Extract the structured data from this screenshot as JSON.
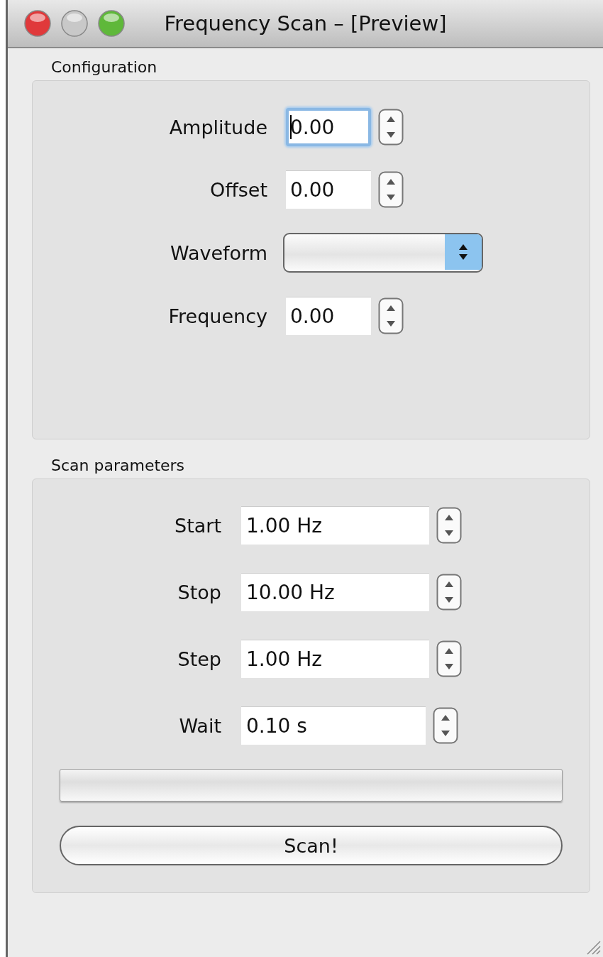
{
  "window": {
    "title": "Frequency Scan – [Preview]",
    "buttons": [
      {
        "kind": "close",
        "disabled": false
      },
      {
        "kind": "minimize",
        "disabled": true
      },
      {
        "kind": "zoom",
        "disabled": false
      }
    ]
  },
  "configuration": {
    "title": "Configuration",
    "fields": [
      {
        "kind": "spin",
        "label": "Amplitude",
        "value": "0.00",
        "focused": true
      },
      {
        "kind": "spin",
        "label": "Offset",
        "value": "0.00",
        "focused": false
      },
      {
        "kind": "dropdown",
        "label": "Waveform",
        "focused": false
      },
      {
        "kind": "spin",
        "label": "Frequency",
        "value": "0.00",
        "focused": false
      }
    ]
  },
  "scan_parameters": {
    "title": "Scan parameters",
    "fields": [
      {
        "label": "Start",
        "value": "1.00 Hz"
      },
      {
        "label": "Stop",
        "value": "10.00 Hz"
      },
      {
        "label": "Step",
        "value": "1.00 Hz"
      },
      {
        "label": "Wait",
        "value": "0.10 s"
      }
    ],
    "progress": {
      "level": 0
    },
    "button": "Scan!"
  }
}
